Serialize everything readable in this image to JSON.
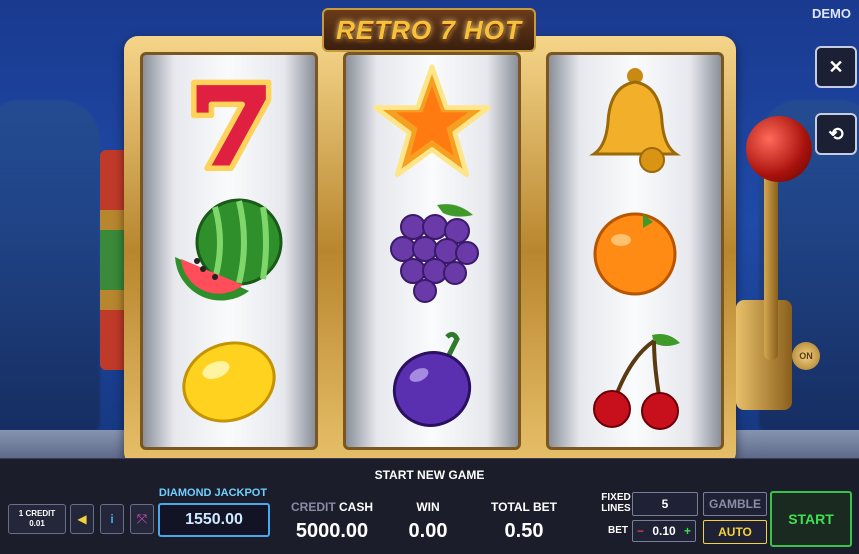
{
  "header": {
    "title": "RETRO 7 HOT",
    "mode": "DEMO"
  },
  "side_buttons": {
    "close": "✕",
    "history": "⟲"
  },
  "reels": [
    [
      "seven",
      "watermelon",
      "lemon"
    ],
    [
      "star",
      "grapes",
      "plum"
    ],
    [
      "bell",
      "orange",
      "cherries"
    ]
  ],
  "lever": {
    "on_label": "ON"
  },
  "message": "START NEW GAME",
  "controls": {
    "credit_button": {
      "line1": "1 CREDIT",
      "line2": "0.01"
    },
    "sound_icon": "speaker-icon",
    "info_icon": "info-icon",
    "fullscreen_icon": "fullscreen-icon",
    "jackpot": {
      "label": "DIAMOND JACKPOT",
      "value": "1550.00"
    },
    "credit": {
      "label_a": "CREDIT",
      "label_b": "CASH",
      "value": "5000.00"
    },
    "win": {
      "label": "WIN",
      "value": "0.00"
    },
    "total_bet": {
      "label": "TOTAL BET",
      "value": "0.50"
    },
    "fixed_lines": {
      "label_line1": "FIXED",
      "label_line2": "LINES",
      "value": "5"
    },
    "bet": {
      "label": "BET",
      "minus": "−",
      "value": "0.10",
      "plus": "+"
    },
    "gamble": "GAMBLE",
    "auto": "AUTO",
    "start": "START"
  },
  "colors": {
    "accent_green": "#3de04f",
    "jackpot_blue": "#6fd0ff",
    "auto_yellow": "#f2d33a",
    "panel": "#1c1d2b"
  }
}
